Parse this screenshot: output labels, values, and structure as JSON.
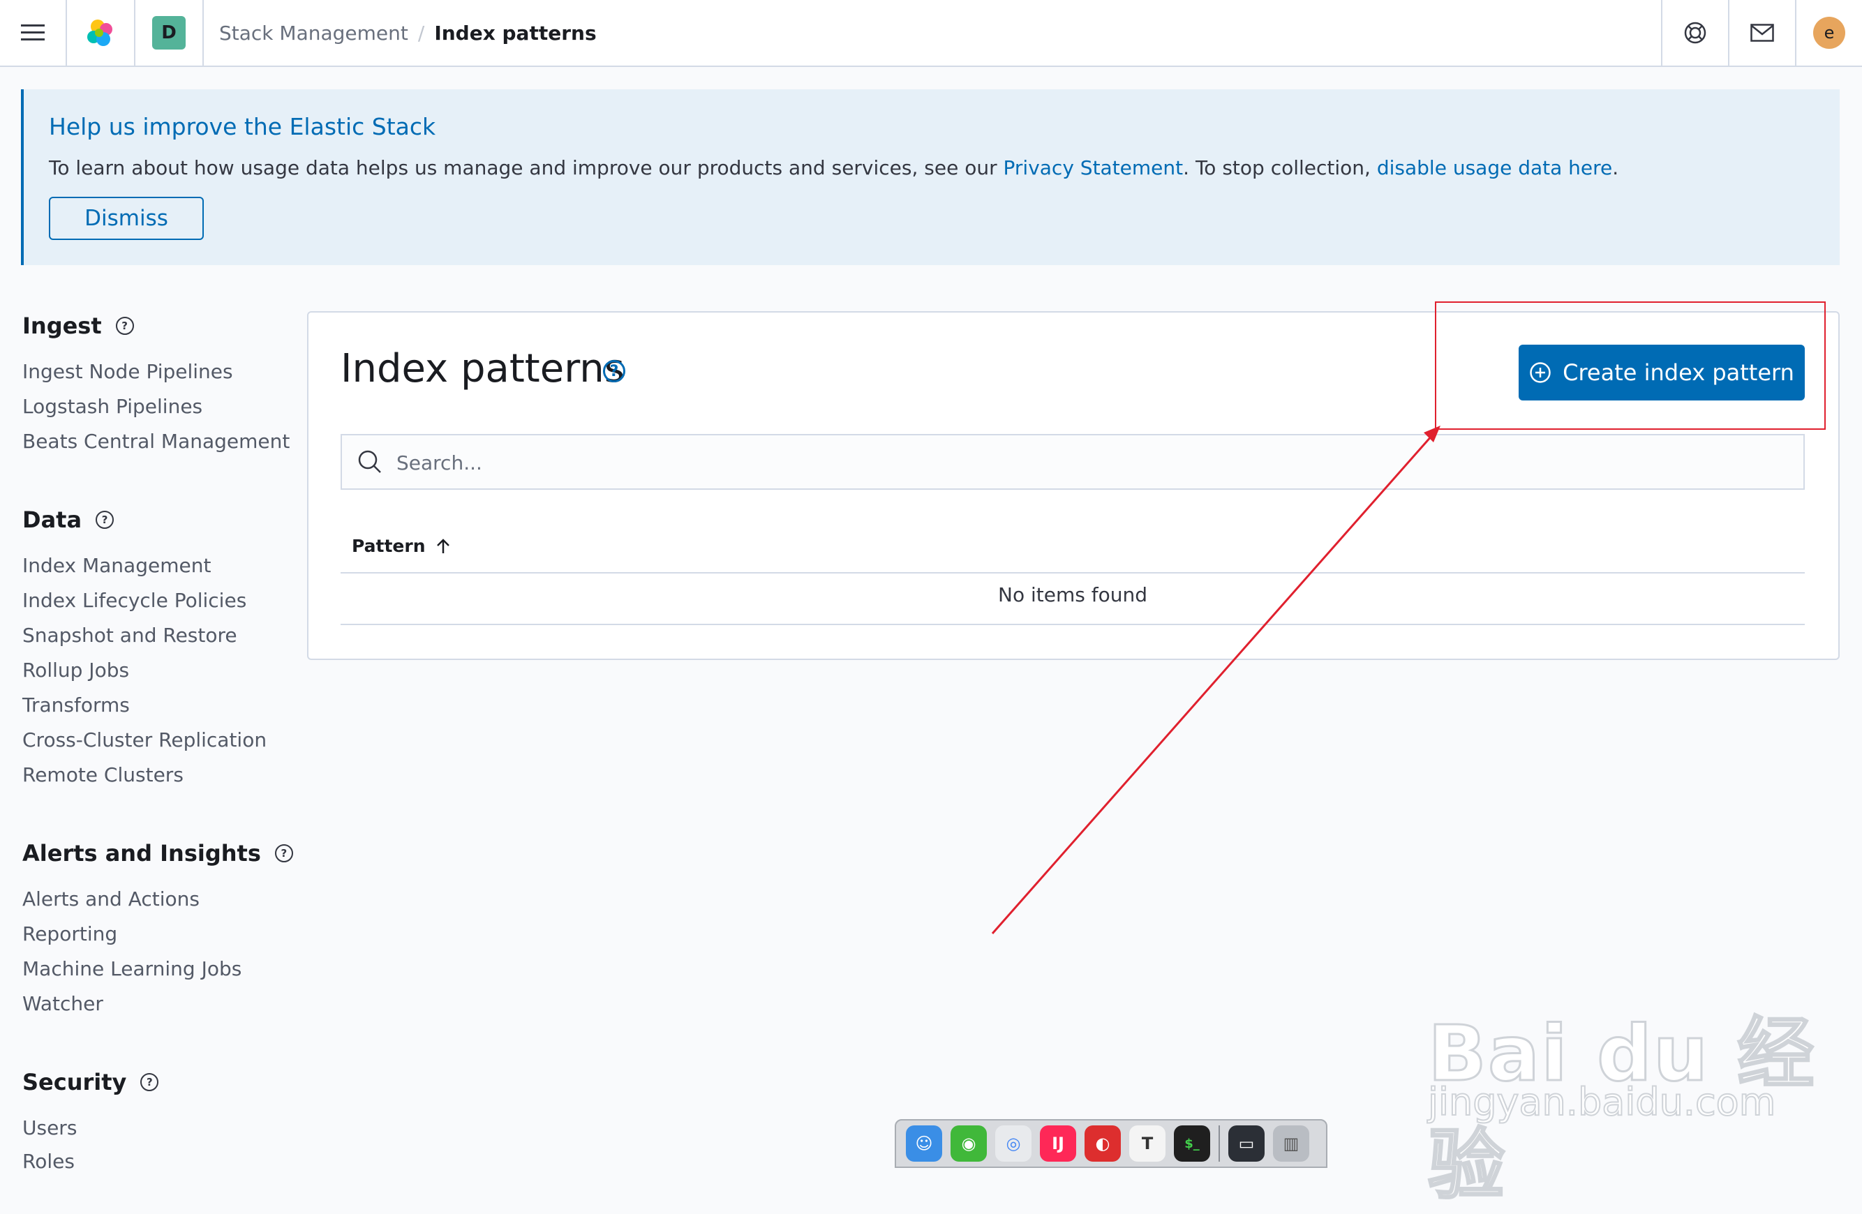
{
  "header": {
    "space_initial": "D",
    "breadcrumbs": [
      "Stack Management",
      "Index patterns"
    ],
    "avatar_initial": "e"
  },
  "callout": {
    "title": "Help us improve the Elastic Stack",
    "text_before": "To learn about how usage data helps us manage and improve our products and services, see our ",
    "privacy_link": "Privacy Statement",
    "text_middle": ". To stop collection, ",
    "disable_link": "disable usage data here",
    "text_after": ".",
    "dismiss_label": "Dismiss"
  },
  "sidebar": {
    "sections": [
      {
        "title": "Ingest",
        "items": [
          "Ingest Node Pipelines",
          "Logstash Pipelines",
          "Beats Central Management"
        ]
      },
      {
        "title": "Data",
        "items": [
          "Index Management",
          "Index Lifecycle Policies",
          "Snapshot and Restore",
          "Rollup Jobs",
          "Transforms",
          "Cross-Cluster Replication",
          "Remote Clusters"
        ]
      },
      {
        "title": "Alerts and Insights",
        "items": [
          "Alerts and Actions",
          "Reporting",
          "Machine Learning Jobs",
          "Watcher"
        ]
      },
      {
        "title": "Security",
        "items": [
          "Users",
          "Roles"
        ]
      }
    ]
  },
  "main": {
    "title": "Index patterns",
    "create_button": "Create index pattern",
    "search_placeholder": "Search...",
    "column_pattern": "Pattern",
    "empty_message": "No items found"
  },
  "watermark": {
    "main": "Bai du 经验",
    "sub": "jingyan.baidu.com"
  },
  "dock": {
    "apps": [
      "finder-icon",
      "wechat-icon",
      "chrome-icon",
      "intellij-icon",
      "netease-music-icon",
      "typora-icon",
      "terminal-icon",
      "screen-icon",
      "trash-icon"
    ]
  },
  "colors": {
    "primary": "#006bb4",
    "annotation_red": "#e0202e",
    "callout_bg": "#e6f0f8"
  }
}
